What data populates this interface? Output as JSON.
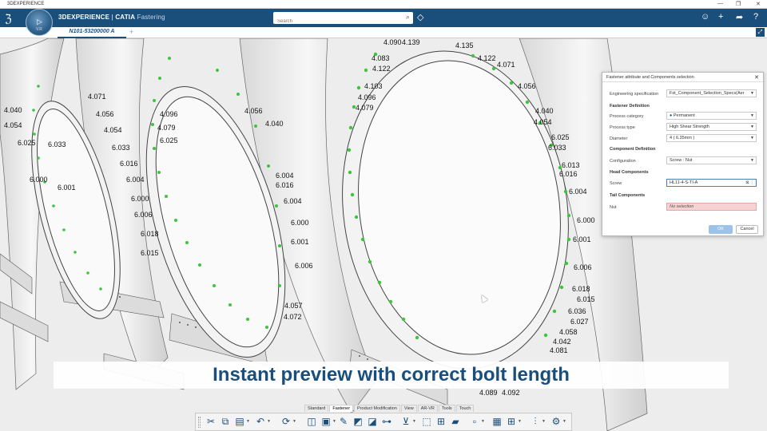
{
  "window": {
    "title": "3DEXPERIENCE"
  },
  "header": {
    "brand": "3DEXPERIENCE",
    "separator": " | ",
    "product": "CATIA",
    "app": "Fastering",
    "compass_version": "V.R",
    "search_placeholder": "Search",
    "icons": [
      "user-icon",
      "plus-icon",
      "share-icon",
      "help-icon"
    ]
  },
  "tabs": [
    {
      "label": "N101-53200000 A"
    }
  ],
  "viewport": {
    "labels": [
      "4.090",
      "4.139",
      "4.135",
      "4.122",
      "4.071",
      "4.083",
      "4.122",
      "4.103",
      "4.096",
      "4.056",
      "4.079",
      "4.040",
      "4.054",
      "6.025",
      "6.033",
      "6.013",
      "6.016",
      "6.004",
      "6.000",
      "6.001",
      "6.006",
      "6.018",
      "6.015",
      "6.036",
      "6.027",
      "4.058",
      "4.042",
      "4.081",
      "4.057",
      "4.072",
      "4.089",
      "4.092"
    ]
  },
  "dialog": {
    "title": "Fastener attribute and Components selection",
    "engineering_spec_label": "Engineering specification",
    "engineering_spec_value": "Fst_Component_Selection_Specs(Aer",
    "fastener_definition": "Fastener Definition",
    "process_category_label": "Process category",
    "process_category_value": "Permanent",
    "process_type_label": "Process type",
    "process_type_value": "High Shear Strength",
    "diameter_label": "Diameter",
    "diameter_value": "4 ( 6.35mm )",
    "component_definition": "Component Definition",
    "configuration_label": "Configuration",
    "configuration_value": "Screw : Nut",
    "head_components": "Head Components",
    "screw_label": "Screw",
    "screw_value": "HL11-4-S-TI-A",
    "tail_components": "Tail Components",
    "nut_label": "Nut",
    "nut_value": "No selection",
    "ok": "OK",
    "cancel": "Cancel"
  },
  "banner": {
    "text": "Instant preview with correct bolt length"
  },
  "toolbar_tabs": [
    "Standard",
    "Fastener",
    "Product Modification",
    "View",
    "AR-VR",
    "Tools",
    "Touch"
  ],
  "toolbar_active_tab": "Fastener",
  "colors": {
    "brand": "#1a4e7b",
    "fastener": "#3ec53e",
    "error_field": "#f6d3d3"
  }
}
